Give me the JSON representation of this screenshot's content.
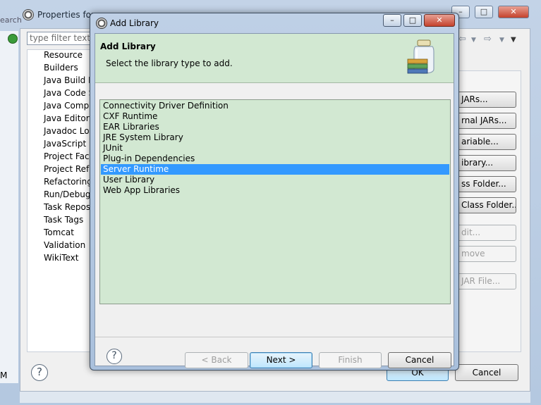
{
  "background_window": {
    "title": "Properties for",
    "search_label": "earch",
    "filter_placeholder": "type filter text",
    "tree_items": [
      "Resource",
      "Builders",
      "Java Build Pa",
      "Java Code St",
      "Java Compil",
      "Java Editor",
      "Javadoc Loc",
      "JavaScript",
      "Project Face",
      "Project Refe",
      "Refactoring",
      "Run/Debug",
      "Task Reposit",
      "Task Tags",
      "Tomcat",
      "Validation",
      "WikiText"
    ],
    "right_buttons": [
      "JARs...",
      "rnal JARs...",
      "ariable...",
      "ibrary...",
      "ss Folder...",
      "Class Folder...",
      "dit...",
      "move",
      "JAR File..."
    ],
    "ok_label": "OK",
    "cancel_label": "Cancel",
    "left_edge_text": "M"
  },
  "dialog": {
    "title": "Add Library",
    "banner_title": "Add Library",
    "banner_description": "Select the library type to add.",
    "library_types": [
      "Connectivity Driver Definition",
      "CXF Runtime",
      "EAR Libraries",
      "JRE System Library",
      "JUnit",
      "Plug-in Dependencies",
      "Server Runtime",
      "User Library",
      "Web App Libraries"
    ],
    "selected_library": "Server Runtime",
    "buttons": {
      "back": "< Back",
      "next": "Next >",
      "finish": "Finish",
      "cancel": "Cancel"
    }
  },
  "icons": {
    "window_icon": "eclipse-gear-icon",
    "banner_icon": "library-jar-icon",
    "help": "help-icon"
  },
  "colors": {
    "selection": "#3399ff",
    "list_background": "#d2e8d2",
    "banner_background": "#d2e8d2"
  }
}
